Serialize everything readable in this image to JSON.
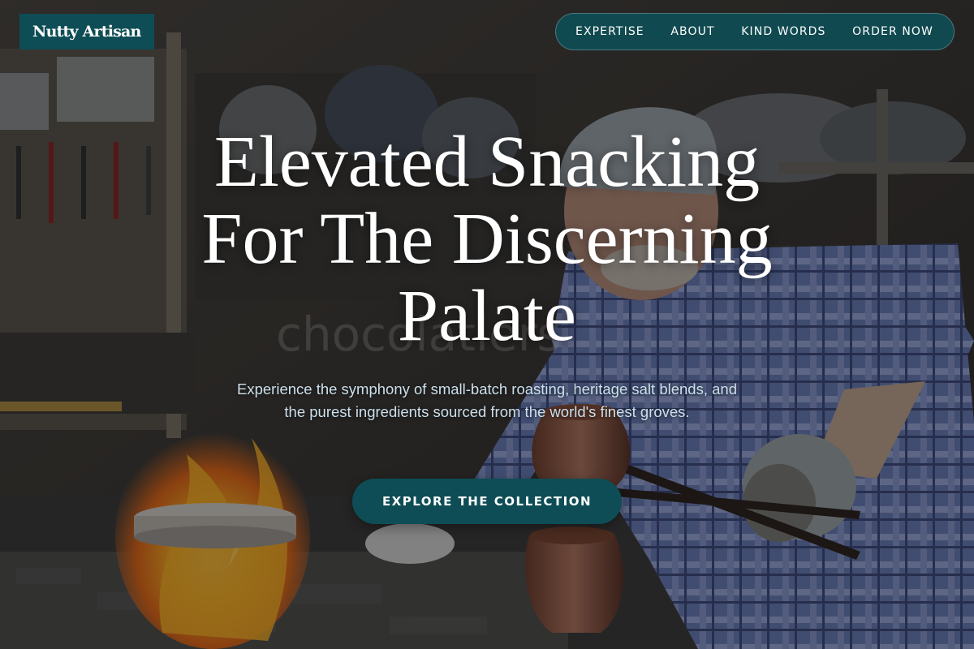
{
  "brand": {
    "name": "Nutty Artisan"
  },
  "nav": {
    "items": [
      {
        "label": "EXPERTISE"
      },
      {
        "label": "ABOUT"
      },
      {
        "label": "KIND WORDS"
      },
      {
        "label": "ORDER NOW"
      }
    ]
  },
  "hero": {
    "title_lines": [
      "Elevated Snacking",
      "For The Discerning",
      "Palate"
    ],
    "subtitle": "Experience the symphony of small-batch roasting, heritage salt blends, and the purest ingredients sourced from the world's finest groves.",
    "cta_label": "EXPLORE THE COLLECTION",
    "background_icon": "artisan-coppersmith-workshop-photo"
  },
  "colors": {
    "accent": "#0e4d55",
    "subtitle_text": "#cbe0ec"
  }
}
